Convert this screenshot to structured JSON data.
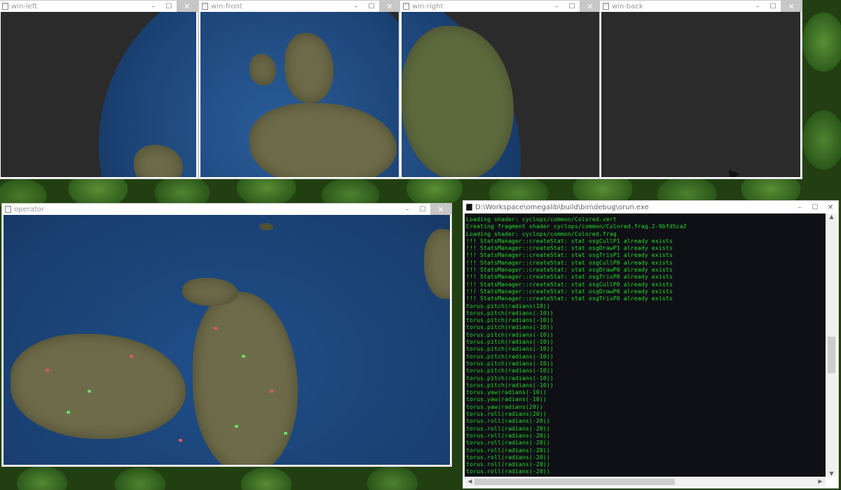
{
  "windows": {
    "win_left": {
      "title": "win-left"
    },
    "win_front": {
      "title": "win-front"
    },
    "win_right": {
      "title": "win-right"
    },
    "win_back": {
      "title": "win-back"
    },
    "operator": {
      "title": "operator"
    },
    "console": {
      "title": "D:\\Workspace\\omegalib\\build\\bin\\debug\\orun.exe",
      "lines": [
        "Loading shader: cyclops/common/Colored.vert",
        "Creating fragment shader cyclops/common/Colored.frag.2-9bfd5ca2",
        "Loading shader: cyclops/common/Colored.frag",
        "!!! StatsManager::createStat: stat osgCullP1 already exists",
        "!!! StatsManager::createStat: stat osgDrawP1 already exists",
        "!!! StatsManager::createStat: stat osgTrisP1 already exists",
        "!!! StatsManager::createStat: stat osgCullP0 already exists",
        "!!! StatsManager::createStat: stat osgDrawP0 already exists",
        "!!! StatsManager::createStat: stat osgTrisP0 already exists",
        "!!! StatsManager::createStat: stat osgCullP0 already exists",
        "!!! StatsManager::createStat: stat osgDrawP0 already exists",
        "!!! StatsManager::createStat: stat osgTrisP0 already exists",
        "torus.pitch(radians(10))",
        "torus.pitch(radians(-10))",
        "torus.pitch(radians(-10))",
        "torus.pitch(radians(-10))",
        "torus.pitch(radians(-10))",
        "torus.pitch(radians(-10))",
        "torus.pitch(radians(-10))",
        "torus.pitch(radians(-10))",
        "torus.pitch(radians(-10))",
        "torus.pitch(radians(-10))",
        "torus.pitch(radians(-10))",
        "torus.pitch(radians(-10))",
        "torus.yaw(radians(-10))",
        "torus.yaw(radians(-10))",
        "torus.yaw(radians(20))",
        "torus.roll(radians(20))",
        "torus.roll(radians(-20))",
        "torus.roll(radians(-20))",
        "torus.roll(radians(-20))",
        "torus.roll(radians(-20))",
        "torus.roll(radians(-20))",
        "torus.roll(radians(-20))",
        "torus.roll(radians(-20))",
        "torus.roll(radians(-20))"
      ]
    }
  },
  "titlebar_buttons": {
    "minimize": "–",
    "maximize": "☐",
    "close": "✕"
  },
  "icons": {
    "window_icon": "app-window-icon",
    "scroll_up": "▲",
    "scroll_down": "▼",
    "scroll_left": "◀",
    "scroll_right": "▶"
  },
  "colors": {
    "console_text": "#27d52c",
    "console_bg": "#0f1015",
    "viewport_dark": "#2b2b2b"
  }
}
